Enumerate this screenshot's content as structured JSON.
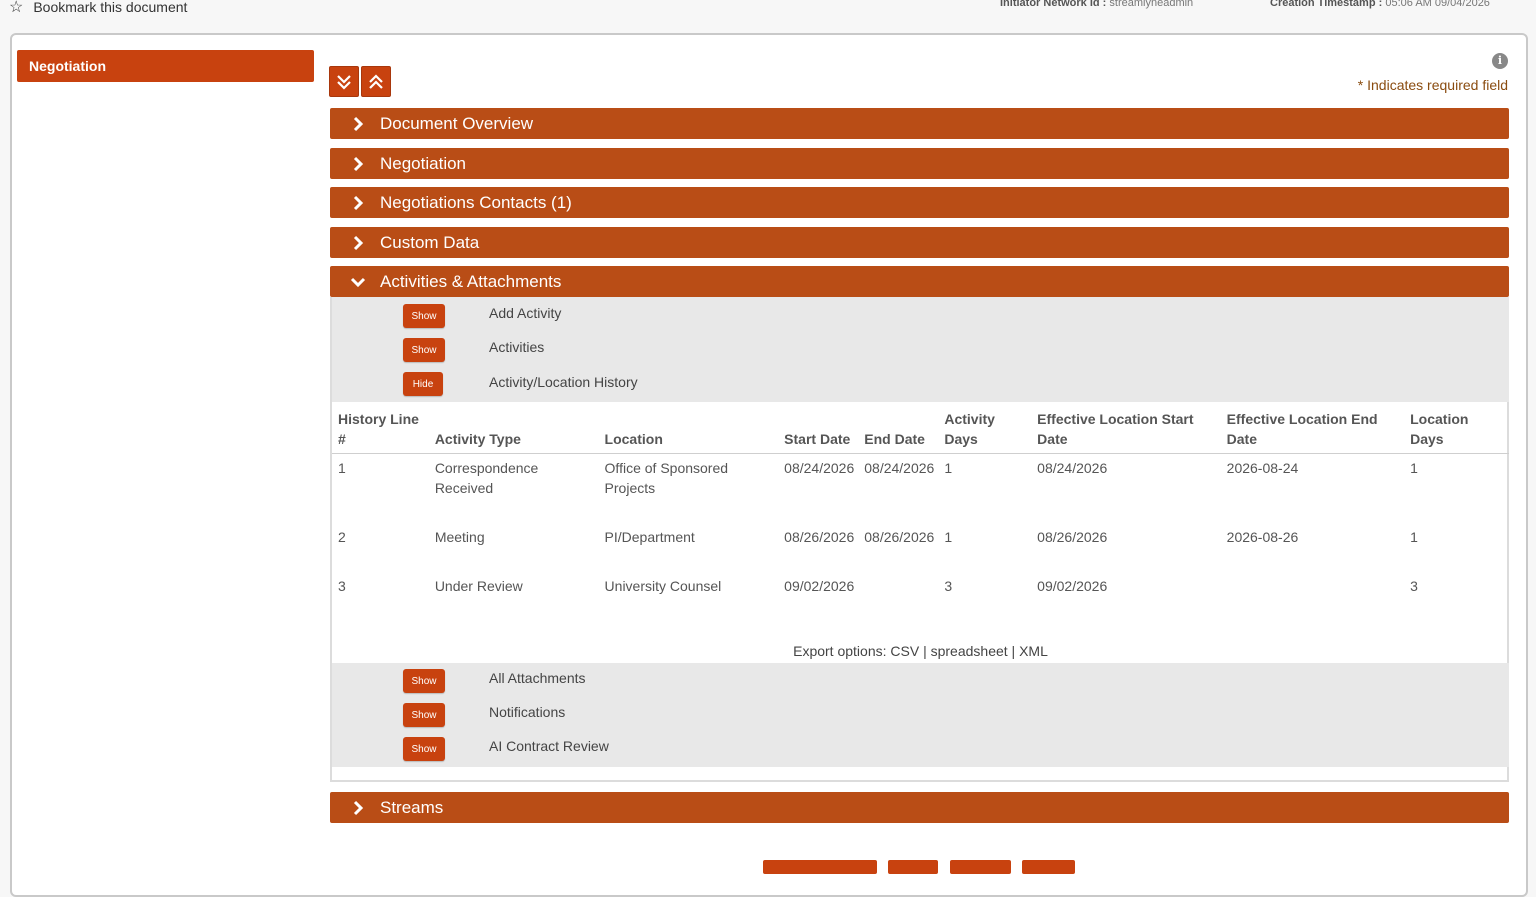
{
  "topbar": {
    "bookmark_label": "Bookmark this document",
    "initiator_label": "Initiator Network Id :",
    "initiator_value": "streamlyneadmin",
    "creation_label": "Creation Timestamp :",
    "creation_value": "05:06 AM 09/04/2026"
  },
  "sidebar": {
    "active_item": "Negotiation"
  },
  "toolbar": {
    "expand_all_icon": "double-chevron-down-icon",
    "collapse_all_icon": "double-chevron-up-icon"
  },
  "required_note": "* Indicates required field",
  "panels": [
    {
      "label": "Document Overview",
      "expanded": false
    },
    {
      "label": "Negotiation",
      "expanded": false
    },
    {
      "label": "Negotiations Contacts (1)",
      "expanded": false
    },
    {
      "label": "Custom Data",
      "expanded": false
    },
    {
      "label": "Activities & Attachments",
      "expanded": true
    },
    {
      "label": "Streams",
      "expanded": false
    }
  ],
  "activities": {
    "top_toggles": [
      {
        "button": "Show",
        "label": "Add Activity"
      },
      {
        "button": "Show",
        "label": "Activities"
      },
      {
        "button": "Hide",
        "label": "Activity/Location History"
      }
    ],
    "history_table": {
      "headers": [
        "History Line #",
        "Activity Type",
        "Location",
        "Start Date",
        "End Date",
        "Activity Days",
        "Effective Location Start Date",
        "Effective Location End Date",
        "Location Days"
      ],
      "rows": [
        [
          "1",
          "Correspondence Received",
          "Office of Sponsored Projects",
          "08/24/2026",
          "08/24/2026",
          "1",
          "08/24/2026",
          "2026-08-24",
          "1"
        ],
        [
          "2",
          "Meeting",
          "PI/Department",
          "08/26/2026",
          "08/26/2026",
          "1",
          "08/26/2026",
          "2026-08-26",
          "1"
        ],
        [
          "3",
          "Under Review",
          "University Counsel",
          "09/02/2026",
          "",
          "3",
          "09/02/2026",
          "",
          "3"
        ]
      ]
    },
    "export": {
      "prefix": "Export options:",
      "csv": "CSV",
      "spreadsheet": "spreadsheet",
      "xml": "XML",
      "sep": " | "
    },
    "bottom_toggles": [
      {
        "button": "Show",
        "label": "All Attachments"
      },
      {
        "button": "Show",
        "label": "Notifications"
      },
      {
        "button": "Show",
        "label": "AI Contract Review"
      }
    ]
  },
  "colors": {
    "accent": "#c8420f",
    "panel": "#b94d16"
  }
}
